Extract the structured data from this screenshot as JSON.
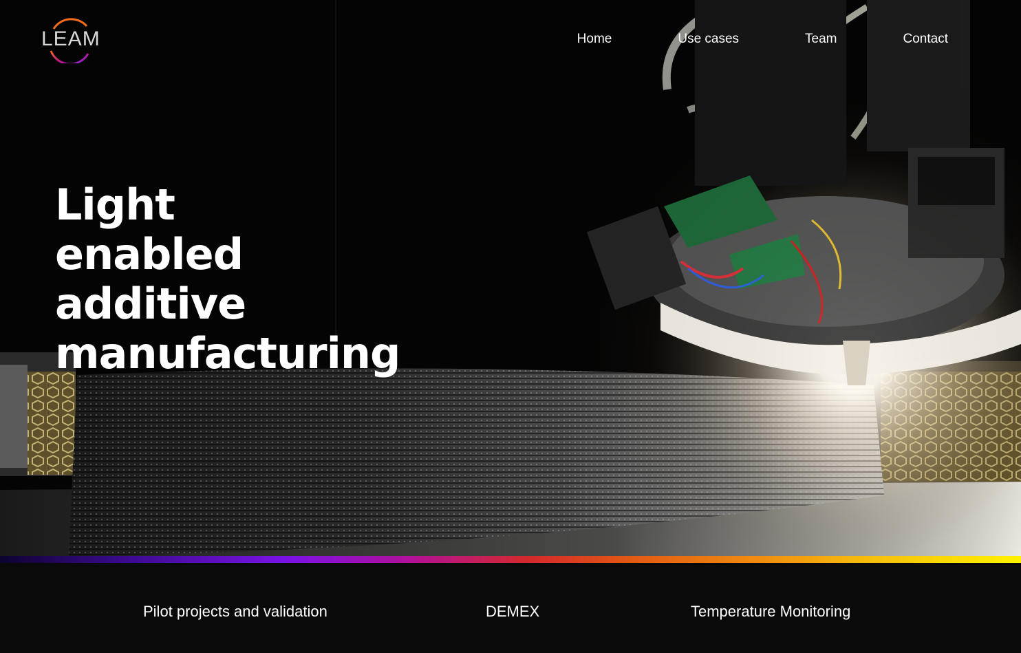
{
  "brand": {
    "logo_text": "LEAM",
    "logo_ring_colors": [
      "#f26d1f",
      "#c2178a",
      "#7a2be0"
    ]
  },
  "nav": {
    "items": [
      {
        "label": "Home"
      },
      {
        "label": "Use cases"
      },
      {
        "label": "Team"
      },
      {
        "label": "Contact"
      }
    ]
  },
  "hero": {
    "headline_lines": [
      "Light",
      "enabled",
      "additive",
      "manufacturing"
    ],
    "image": "3d-printer-nozzle-with-bright-light-over-layered-print"
  },
  "accent_gradient": [
    "#0d0330",
    "#7a12e6",
    "#d42a2a",
    "#f08c10",
    "#fff200"
  ],
  "sections": {
    "links": [
      {
        "label": "Pilot projects and validation"
      },
      {
        "label": "DEMEX"
      },
      {
        "label": "Temperature Monitoring"
      }
    ]
  }
}
